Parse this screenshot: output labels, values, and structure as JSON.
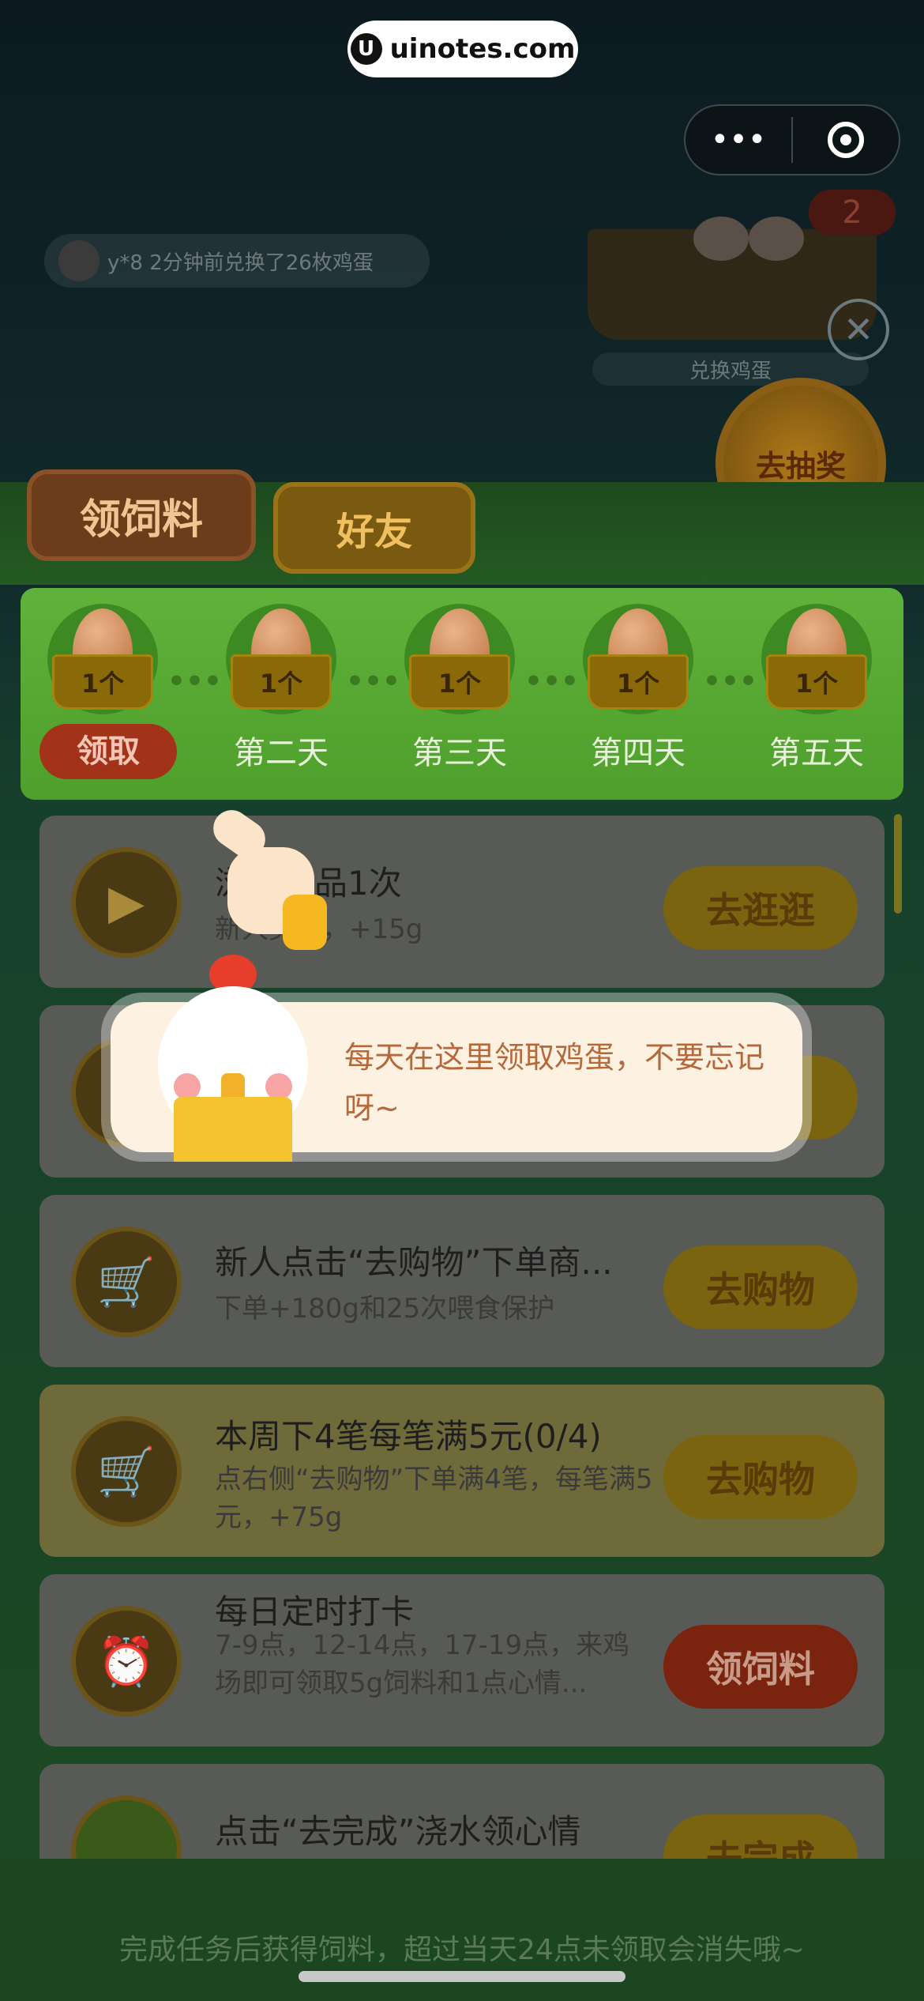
{
  "watermark": {
    "text": "uinotes.com",
    "icon": "u-logo-icon"
  },
  "capsule": {
    "more_icon": "•••",
    "target_icon": "target-icon"
  },
  "marquee": {
    "text": "y*8  2分钟前兑换了26枚鸡蛋"
  },
  "basket": {
    "badge": "2",
    "label": "兑换鸡蛋"
  },
  "close": {
    "icon": "✕"
  },
  "lottery": {
    "label": "去抽奖"
  },
  "tabs": [
    {
      "label": "领饲料"
    },
    {
      "label": "好友"
    }
  ],
  "egg_days": [
    {
      "count": "1个",
      "label": "领取",
      "is_button": true
    },
    {
      "count": "1个",
      "label": "第二天"
    },
    {
      "count": "1个",
      "label": "第三天"
    },
    {
      "count": "1个",
      "label": "第四天"
    },
    {
      "count": "1个",
      "label": "第五天"
    }
  ],
  "tasks": [
    {
      "title": "浏览商品1次",
      "desc": "新人奖励，+15g",
      "button": "去逛逛"
    },
    {
      "title": "",
      "desc": "",
      "button": "逛"
    },
    {
      "title": "新人点击“去购物”下单商...",
      "desc": "下单+180g和25次喂食保护",
      "button": "去购物"
    },
    {
      "title": "本周下4笔每笔满5元(0/4)",
      "desc": "点右侧“去购物”下单满4笔，每笔满5元，+75g",
      "button": "去购物"
    },
    {
      "title": "每日定时打卡",
      "desc": "7-9点，12-14点，17-19点，来鸡场即可领取5g饲料和1点心情...",
      "button": "领饲料"
    },
    {
      "title": "点击“去完成”浇水领心情",
      "desc": "",
      "button": "去完成"
    }
  ],
  "guide_bubble": {
    "text": "每天在这里领取鸡蛋，不要忘记呀~"
  },
  "bottom_tip": {
    "text": "完成任务后获得饲料，超过当天24点未领取会消失哦~"
  }
}
